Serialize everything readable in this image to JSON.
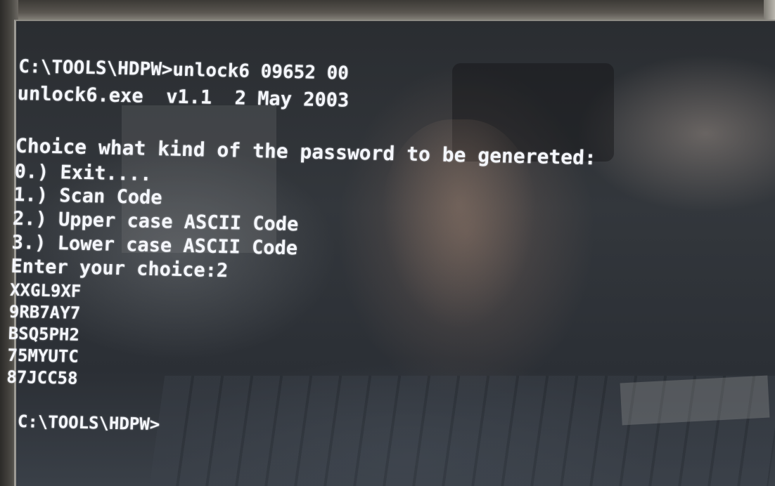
{
  "terminal": {
    "lines": [
      "C:\\TOOLS\\HDPW>unlock6 09652 00",
      "unlock6.exe  v1.1  2 May 2003",
      "",
      "Choice what kind of the password to be genereted:",
      "0.) Exit....",
      "1.) Scan Code",
      "2.) Upper case ASCII Code",
      "3.) Lower case ASCII Code",
      "Enter your choice:2",
      "XXGL9XF",
      "9RB7AY7",
      "BSQ5PH2",
      "75MYUTC",
      "87JCC58",
      "",
      "C:\\TOOLS\\HDPW>"
    ],
    "text_color": "#f4f6fb"
  }
}
